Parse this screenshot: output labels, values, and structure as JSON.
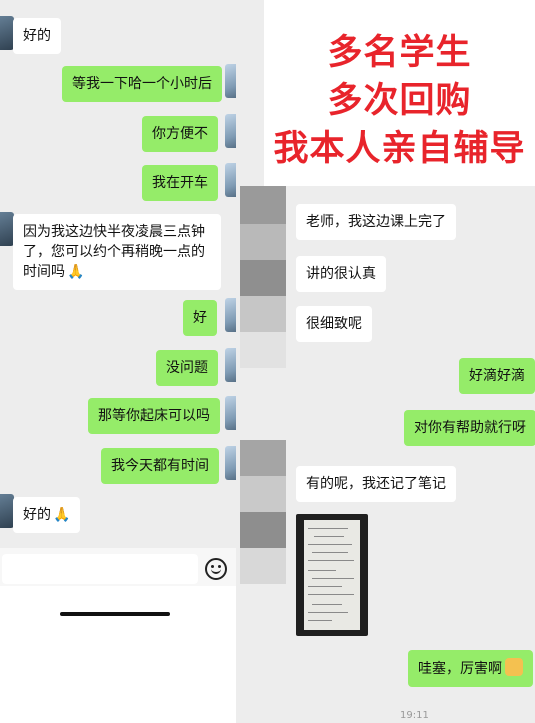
{
  "banner": {
    "line1": "多名学生",
    "line2": "多次回购",
    "line3": "我本人亲自辅导"
  },
  "left_chat": {
    "messages": [
      {
        "side": "in",
        "text": "好的"
      },
      {
        "side": "out",
        "text": "等我一下哈一个小时后"
      },
      {
        "side": "out",
        "text": "你方便不"
      },
      {
        "side": "out",
        "text": "我在开车"
      },
      {
        "side": "in",
        "text": "因为我这边快半夜凌晨三点钟了，您可以约个再稍晚一点的时间吗"
      },
      {
        "side": "out",
        "text": "好"
      },
      {
        "side": "out",
        "text": "没问题"
      },
      {
        "side": "out",
        "text": "那等你起床可以吗"
      },
      {
        "side": "out",
        "text": "我今天都有时间"
      },
      {
        "side": "in",
        "text": "好的"
      }
    ],
    "input_placeholder": "",
    "emoji_icon": "emoji-face-icon",
    "pray_emoji": "🙏"
  },
  "right_chat": {
    "messages": [
      {
        "side": "in",
        "text": "老师，我这边课上完了"
      },
      {
        "side": "in",
        "text": "讲的很认真"
      },
      {
        "side": "in",
        "text": "很细致呢"
      },
      {
        "side": "out",
        "text": "好滴好滴"
      },
      {
        "side": "out",
        "text": "对你有帮助就行呀"
      },
      {
        "side": "in",
        "text": "有的呢，我还记了笔记"
      },
      {
        "side": "in",
        "type": "image",
        "alt": "notes-photo"
      },
      {
        "side": "out",
        "text": "哇塞，厉害啊"
      }
    ],
    "timestamp": "19:11"
  },
  "colors": {
    "outgoing": "#95ec69",
    "incoming": "#ffffff",
    "banner_text": "#e8242b",
    "background": "#ededed"
  }
}
